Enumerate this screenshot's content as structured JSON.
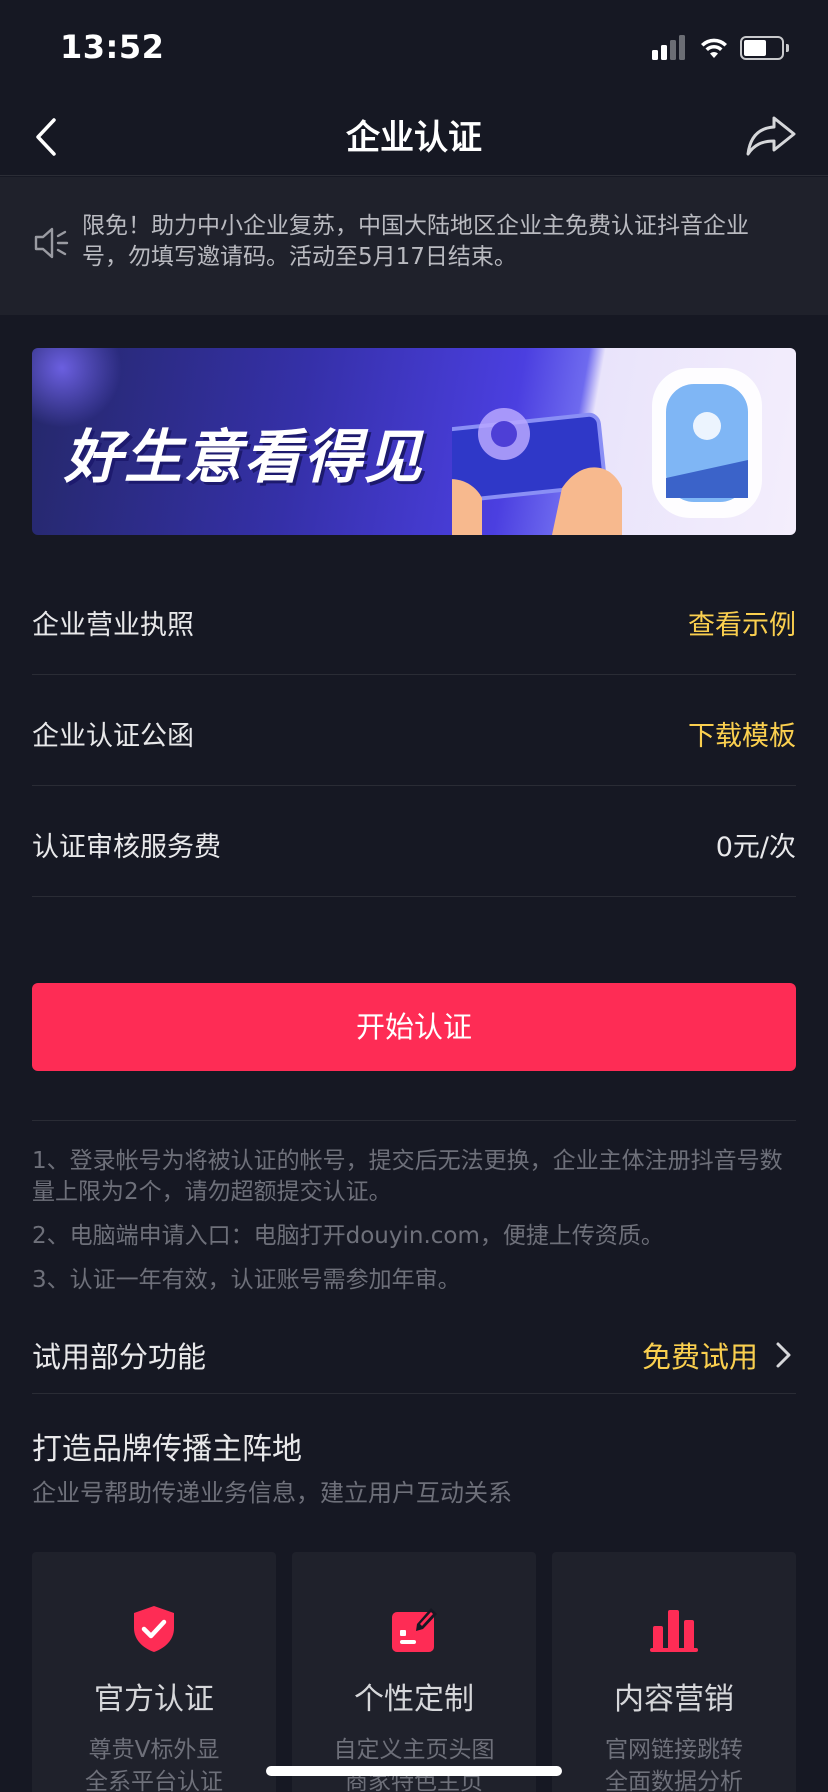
{
  "status_bar": {
    "time": "13:52",
    "icons": [
      "signal-icon",
      "wifi-icon",
      "battery-icon"
    ]
  },
  "nav": {
    "title": "企业认证",
    "back_icon": "chevron-left-icon",
    "share_icon": "share-icon"
  },
  "notice": {
    "icon": "speaker-icon",
    "text": "限免！助力中小企业复苏，中国大陆地区企业主免费认证抖音企业号，勿填写邀请码。活动至5月17日结束。"
  },
  "banner": {
    "title": "好生意看得见"
  },
  "info_rows": [
    {
      "label": "企业营业执照",
      "value": "查看示例"
    },
    {
      "label": "企业认证公函",
      "value": "下载模板"
    },
    {
      "label": "认证审核服务费",
      "value": "0元/次"
    }
  ],
  "primary_button": {
    "label": "开始认证"
  },
  "notes": [
    "1、登录帐号为将被认证的帐号，提交后无法更换，企业主体注册抖音号数量上限为2个，请勿超额提交认证。",
    "2、电脑端申请入口：电脑打开douyin.com，便捷上传资质。",
    "3、认证一年有效，认证账号需参加年审。"
  ],
  "trial": {
    "label": "试用部分功能",
    "link": "免费试用"
  },
  "section": {
    "title": "打造品牌传播主阵地",
    "subtitle": "企业号帮助传递业务信息，建立用户互动关系"
  },
  "cards": [
    {
      "icon": "shield-check-icon",
      "title": "官方认证",
      "desc": [
        "尊贵V标外显",
        "全系平台认证"
      ]
    },
    {
      "icon": "custom-edit-icon",
      "title": "个性定制",
      "desc": [
        "自定义主页头图",
        "商家特色主页"
      ]
    },
    {
      "icon": "bar-chart-icon",
      "title": "内容营销",
      "desc": [
        "官网链接跳转",
        "全面数据分析"
      ]
    }
  ],
  "colors": {
    "background": "#161823",
    "accent_yellow": "#facf4f",
    "primary_red": "#fe2c55",
    "icon_red": "#fe2c55"
  }
}
